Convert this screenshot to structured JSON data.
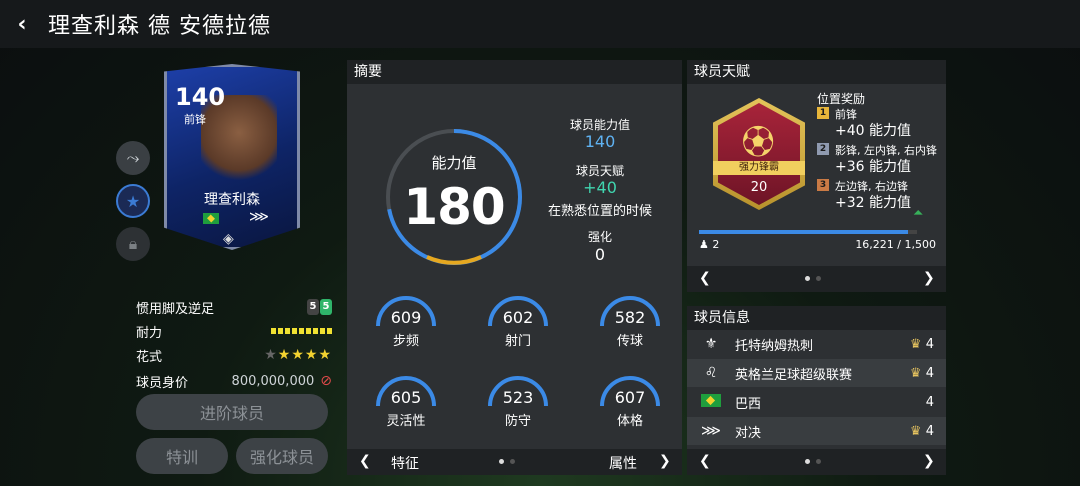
{
  "header": {
    "back_icon": "‹",
    "title": "理查利森 德 安德拉德"
  },
  "card": {
    "rating": "140",
    "position": "前锋",
    "name": "理查利森"
  },
  "attributes": {
    "weak_foot_label": "惯用脚及逆足",
    "weak_foot_left": "5",
    "weak_foot_right": "5",
    "stamina_label": "耐力",
    "stamina_level": 9,
    "skills_label": "花式",
    "skill_stars": 4,
    "skill_stars_max": 5,
    "value_label": "球员身价",
    "value": "800,000,000"
  },
  "buttons": {
    "advance": "进阶球员",
    "train": "特训",
    "enhance": "强化球员"
  },
  "summary": {
    "title": "摘要",
    "ovr_label": "能力值",
    "ovr_value": "180",
    "ovr_fraction": 0.72,
    "ability_label": "球员能力值",
    "ability_value": "140",
    "talent_label": "球员天赋",
    "talent_value": "+40",
    "talent_desc": "在熟悉位置的时候",
    "enhance_label": "强化",
    "enhance_value": "0",
    "stats": [
      {
        "label": "步频",
        "value": "609"
      },
      {
        "label": "射门",
        "value": "602"
      },
      {
        "label": "传球",
        "value": "582"
      },
      {
        "label": "灵活性",
        "value": "605"
      },
      {
        "label": "防守",
        "value": "523"
      },
      {
        "label": "体格",
        "value": "607"
      }
    ],
    "footer_left": "特征",
    "footer_right": "属性"
  },
  "talent": {
    "title": "球员天赋",
    "badge_name": "强力锋霸",
    "badge_level": "20",
    "bonus_title": "位置奖励",
    "bonuses": [
      {
        "num": "1",
        "positions": "前锋",
        "bonus": "+40 能力值",
        "color": "#e8b63a"
      },
      {
        "num": "2",
        "positions": "影锋, 左内锋, 右内锋",
        "bonus": "+36 能力值",
        "color": "#8f9ab0"
      },
      {
        "num": "3",
        "positions": "左边锋, 右边锋",
        "bonus": "+32 能力值",
        "color": "#c97a45"
      }
    ],
    "count": "2",
    "progress_text": "16,221 / 1,500",
    "progress_fraction": 0.96
  },
  "info": {
    "title": "球员信息",
    "rows": [
      {
        "icon": "club-crest-icon",
        "text": "托特纳姆热刺",
        "chem": "4"
      },
      {
        "icon": "league-crest-icon",
        "text": "英格兰足球超级联赛",
        "chem": "4"
      },
      {
        "icon": "brazil-flag-icon",
        "text": "巴西",
        "chem": "4"
      },
      {
        "icon": "program-icon",
        "text": "对决",
        "chem": "4"
      }
    ]
  },
  "colors": {
    "accent_blue": "#3b8ae6",
    "teal": "#40d6b0",
    "gold": "#e8c560"
  }
}
